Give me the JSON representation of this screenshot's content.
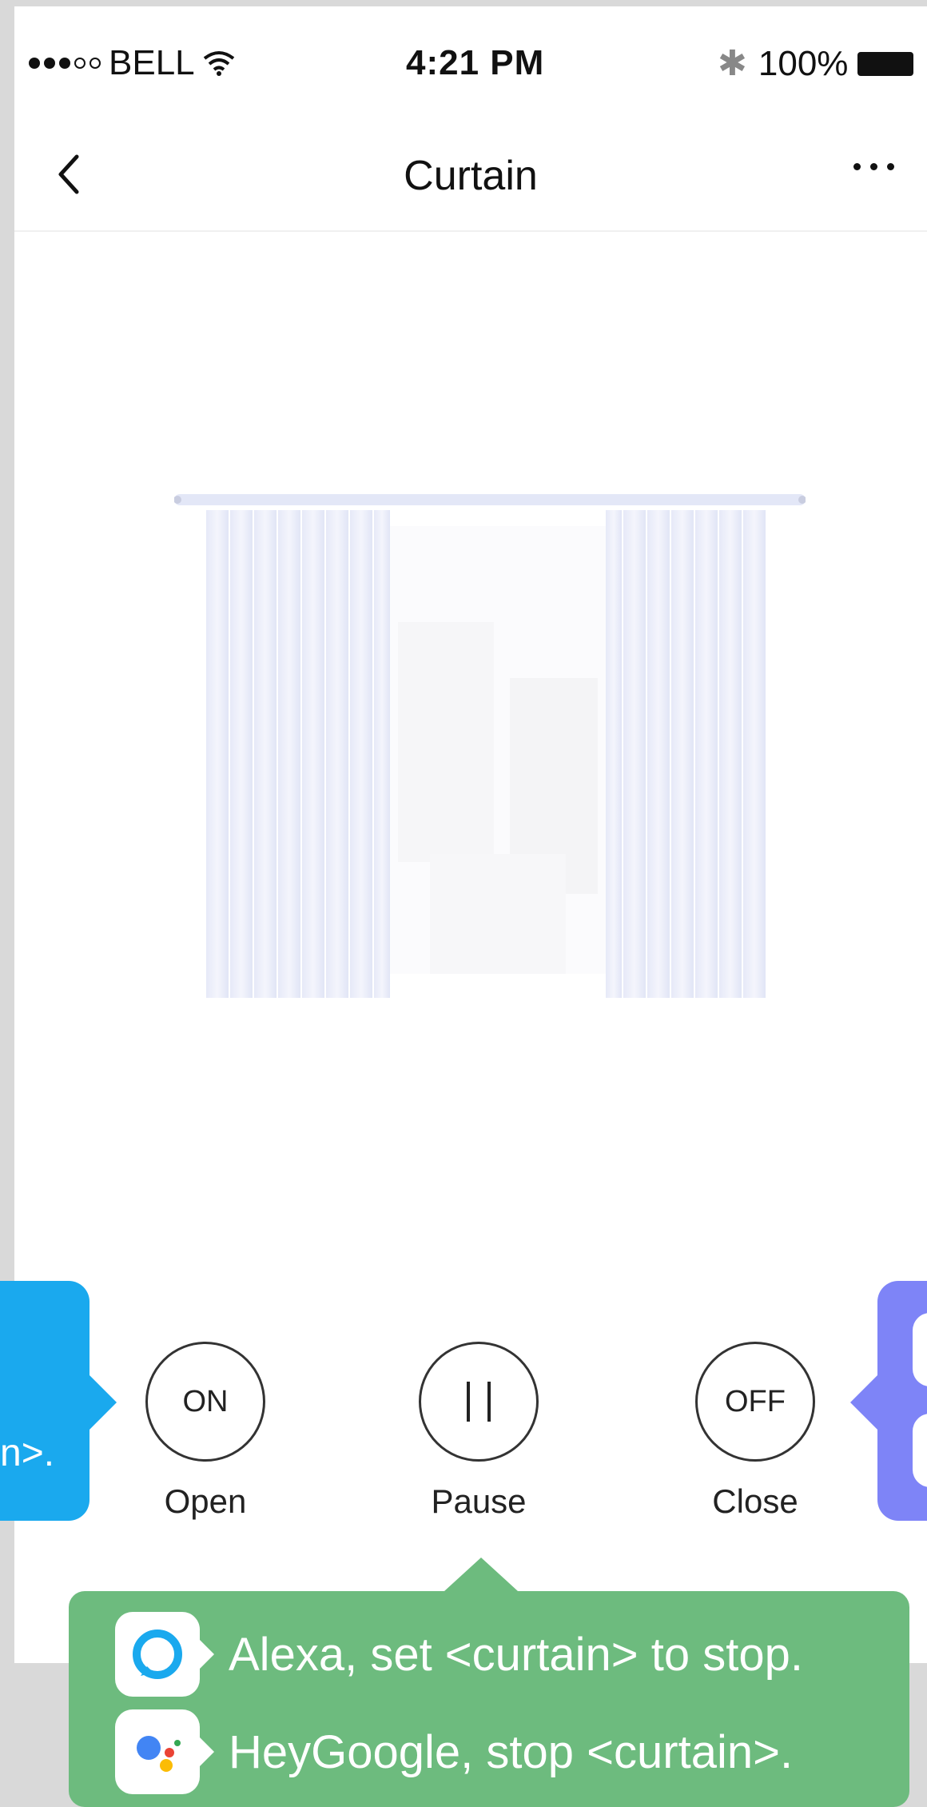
{
  "status_bar": {
    "carrier": "BELL",
    "time": "4:21 PM",
    "battery": "100%"
  },
  "nav": {
    "title": "Curtain"
  },
  "controls": {
    "open": {
      "icon_text": "ON",
      "label": "Open"
    },
    "pause": {
      "label": "Pause"
    },
    "close": {
      "icon_text": "OFF",
      "label": "Close"
    }
  },
  "voice_hints": {
    "left_partial": "n>.",
    "alexa": "Alexa, set <curtain> to stop.",
    "google": "HeyGoogle, stop <curtain>."
  },
  "colors": {
    "alexa_bubble": "#1aa9ee",
    "google_bubble": "#7e84f7",
    "pause_bubble": "#6dbb7e",
    "curtain": "#e3e7f7"
  },
  "icons": [
    "back-icon",
    "more-icon",
    "wifi-icon",
    "bluetooth-icon",
    "battery-icon",
    "pause-icon",
    "alexa-icon",
    "google-assistant-icon"
  ]
}
